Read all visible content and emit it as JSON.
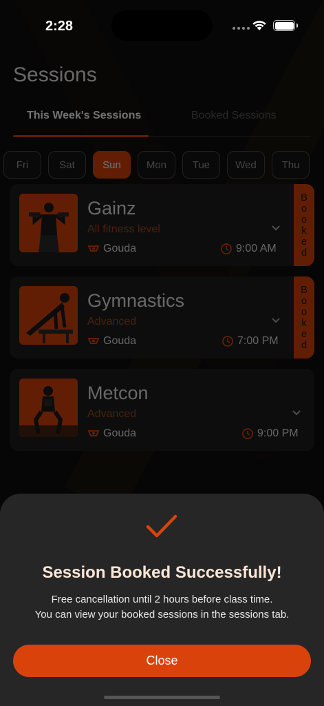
{
  "status_bar": {
    "time": "2:28"
  },
  "header": {
    "title": "Sessions"
  },
  "tabs": [
    {
      "label": "This Week's Sessions",
      "active": true
    },
    {
      "label": "Booked Sessions",
      "active": false
    }
  ],
  "days": [
    {
      "label": "Fri",
      "active": false
    },
    {
      "label": "Sat",
      "active": false
    },
    {
      "label": "Sun",
      "active": true
    },
    {
      "label": "Mon",
      "active": false
    },
    {
      "label": "Tue",
      "active": false
    },
    {
      "label": "Wed",
      "active": false
    },
    {
      "label": "Thu",
      "active": false
    }
  ],
  "sessions": [
    {
      "name": "Gainz",
      "level": "All fitness level",
      "coach": "Gouda",
      "time": "9:00 AM",
      "booked": true
    },
    {
      "name": "Gymnastics",
      "level": "Advanced",
      "coach": "Gouda",
      "time": "7:00 PM",
      "booked": true
    },
    {
      "name": "Metcon",
      "level": "Advanced",
      "coach": "Gouda",
      "time": "9:00 PM",
      "booked": false
    }
  ],
  "booked_label": "Booked",
  "sheet": {
    "title": "Session Booked Successfully!",
    "line1": "Free cancellation until 2 hours before class time.",
    "line2": "You can view your booked sessions in the sessions tab.",
    "button": "Close"
  },
  "colors": {
    "accent": "#d9430b",
    "card": "#1e1e1e",
    "sheet": "#262626"
  }
}
